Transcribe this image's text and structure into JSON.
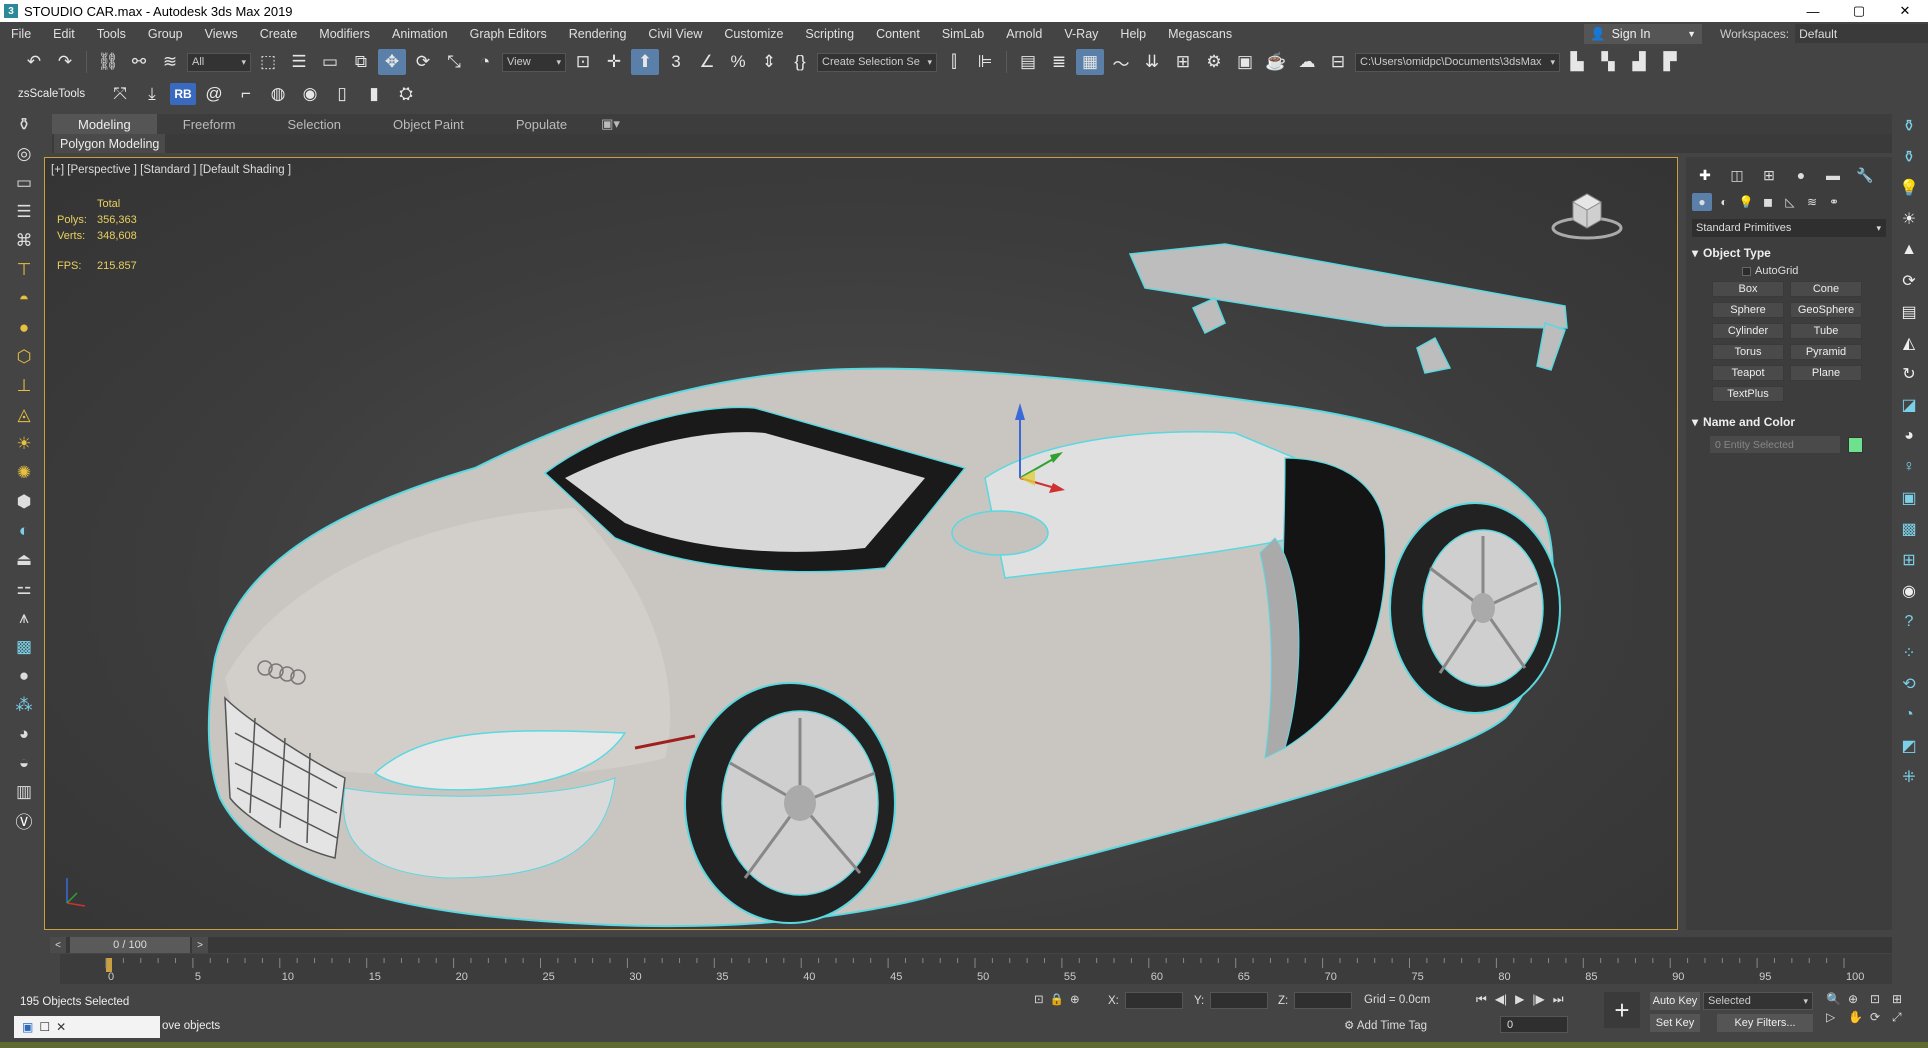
{
  "titlebar": {
    "title": "STOUDIO  CAR.max - Autodesk 3ds Max 2019",
    "app_icon": "3",
    "minimize": "—",
    "maximize": "▢",
    "close": "✕"
  },
  "menu": [
    "File",
    "Edit",
    "Tools",
    "Group",
    "Views",
    "Create",
    "Modifiers",
    "Animation",
    "Graph Editors",
    "Rendering",
    "Civil View",
    "Customize",
    "Scripting",
    "Content",
    "SimLab",
    "Arnold",
    "V-Ray",
    "Help",
    "Megascans"
  ],
  "account": {
    "signin": "Sign In",
    "workspaces_label": "Workspaces:",
    "workspace": "Default"
  },
  "toolbar": {
    "selection_filter": "All",
    "ref_coord": "View",
    "named_selection": "Create Selection Se",
    "project_path": "C:\\Users\\omidpc\\Documents\\3dsMax",
    "zs_label": "zsScaleTools",
    "rb_label": "RB"
  },
  "ribbon": {
    "tabs": [
      "Modeling",
      "Freeform",
      "Selection",
      "Object Paint",
      "Populate"
    ],
    "active_tab": "Modeling",
    "subpanel": "Polygon Modeling"
  },
  "viewport": {
    "label": "[+] [Perspective ] [Standard ] [Default Shading ]",
    "stats": {
      "header": "Total",
      "polys_label": "Polys:",
      "polys": "356,363",
      "verts_label": "Verts:",
      "verts": "348,608",
      "fps_label": "FPS:",
      "fps": "215.857"
    }
  },
  "command_panel": {
    "category": "Standard Primitives",
    "object_type_header": "Object Type",
    "autogrid": "AutoGrid",
    "primitives": [
      "Box",
      "Cone",
      "Sphere",
      "GeoSphere",
      "Cylinder",
      "Tube",
      "Torus",
      "Pyramid",
      "Teapot",
      "Plane",
      "TextPlus"
    ],
    "name_color_header": "Name and Color",
    "name_placeholder": "0 Entity Selected",
    "object_color": "#6ee08e"
  },
  "timeline": {
    "frame_display": "0 / 100",
    "ticks": [
      "0",
      "5",
      "10",
      "15",
      "20",
      "25",
      "30",
      "35",
      "40",
      "45",
      "50",
      "55",
      "60",
      "65",
      "70",
      "75",
      "80",
      "85",
      "90",
      "95",
      "100"
    ]
  },
  "status": {
    "selected": "195 Objects Selected",
    "prompt": "ove objects",
    "x_label": "X:",
    "y_label": "Y:",
    "z_label": "Z:",
    "grid": "Grid = 0.0cm",
    "add_time_tag": "Add Time Tag",
    "current_frame": "0",
    "auto_key": "Auto Key",
    "set_key": "Set Key",
    "key_mode": "Selected",
    "key_filters": "Key Filters..."
  },
  "colors": {
    "selection_outline": "#5ad8e0",
    "viewport_border": "#c8a040",
    "active_tool": "#5a7fa8"
  }
}
